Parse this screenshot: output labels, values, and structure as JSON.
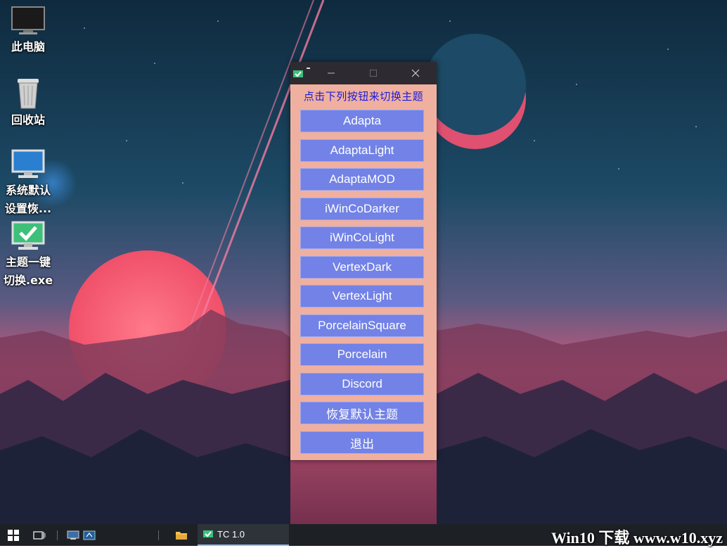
{
  "desktop": {
    "icons": [
      {
        "label": "此电脑",
        "icon": "computer-icon"
      },
      {
        "label": "回收站",
        "icon": "recycle-bin-icon"
      },
      {
        "label": "系统默认\n设置恢...",
        "icon": "monitor-icon"
      },
      {
        "label": "主题一键\n切换.exe",
        "icon": "checkmark-app-icon"
      }
    ]
  },
  "window": {
    "heading": "点击下列按钮来切换主题",
    "buttons": [
      "Adapta",
      "AdaptaLight",
      "AdaptaMOD",
      "iWinCoDarker",
      "iWinCoLight",
      "VertexDark",
      "VertexLight",
      "PorcelainSquare",
      "Porcelain",
      "Discord",
      "恢复默认主题",
      "退出"
    ],
    "colors": {
      "background": "#f0b0a0",
      "button": "#7282e6",
      "heading": "#1b1bd8",
      "titlebar": "#2d2b31"
    }
  },
  "taskbar": {
    "app_label": "TC 1.0",
    "watermark": "Win10 下载 www.w10.xyz"
  }
}
